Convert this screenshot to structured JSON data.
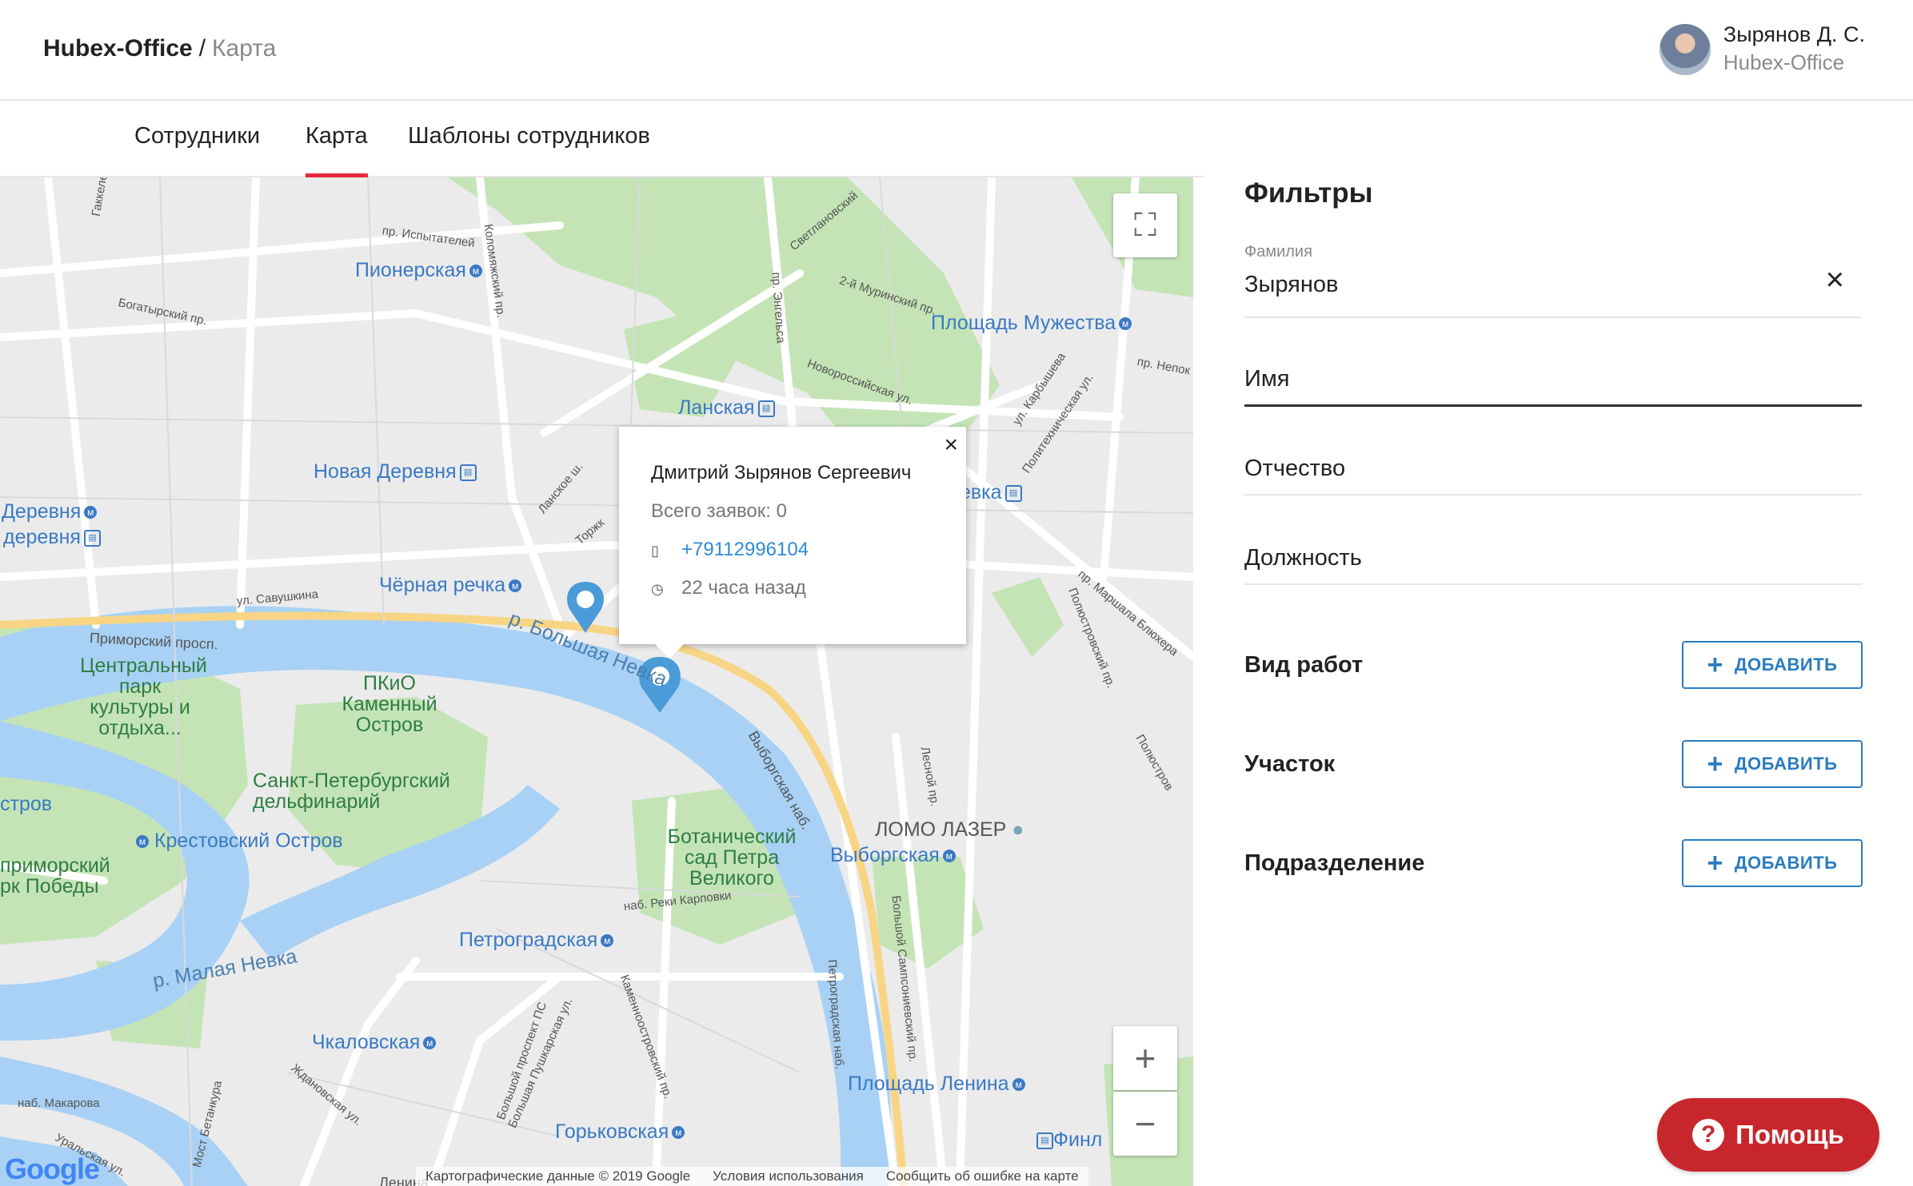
{
  "header": {
    "app_name": "Hubex-Office",
    "separator": "/",
    "page_name": "Карта",
    "user_name": "Зырянов Д. С.",
    "user_org": "Hubex-Office"
  },
  "tabs": [
    {
      "label": "Сотрудники",
      "active": false
    },
    {
      "label": "Карта",
      "active": true
    },
    {
      "label": "Шаблоны сотрудников",
      "active": false
    }
  ],
  "map": {
    "labels": {
      "pionerskaya": "Пионерская",
      "ploschad_muzhestva": "Площадь Мужества",
      "lanskaya": "Ланская",
      "novaya_derevnya": "Новая Деревня",
      "derevnya1": "Деревня",
      "derevnya2": "деревня",
      "chernaya_rechka": "Чёрная речка",
      "park_kultury": "Центральный парк культуры и отдыха...",
      "pkio": "ПКиО Каменный Остров",
      "dolfinarium": "Санкт-Петербургский дельфинарий",
      "krestovsky": "Крестовский Остров",
      "primorsky": "приморский рк Победы",
      "strov": "стров",
      "botanic": "Ботанический сад Петра Великого",
      "lomo": "ЛОМО ЛАЗЕР",
      "vyborgskaya": "Выборгская",
      "petrogradskaya": "Петроградская",
      "malaya_nevka": "р. Малая Невка",
      "bolshaya_nevka": "р. Большая Невка",
      "chkalovskaya": "Чкаловская",
      "ploschad_lenina": "Площадь Ленина",
      "gorkovskaya": "Горьковская",
      "finl": "Финл",
      "vka": "евка",
      "primorsky_prosp": "Приморский просп.",
      "vyborgskaya_nab": "Выборгская наб.",
      "ul_savushkina": "ул. Савушкина",
      "pr_ispytateley": "пр. Испытателей",
      "bogatyrsky": "Богатырский пр.",
      "kolomyazhsky": "Коломяжский пр.",
      "murinsky": "2-й Муринский пр.",
      "novorossiyskaya": "Новороссийская ул.",
      "nab_reki_karpovki": "наб. Реки Карповки",
      "svetlanovsky": "Светлановский",
      "engelsa": "пр. Энгельса",
      "lanskoe": "Ланское ш.",
      "marshala": "пр. Маршала Блюхера",
      "polyustrovsky": "Полюстровский пр.",
      "lesnoy": "Лесной пр.",
      "bolshoy_sampsonievsky": "Большой Сампсониевский пр.",
      "petrogradskaya_nab": "Петроградская наб.",
      "kamennoostrovsky": "Каменноостровский пр.",
      "bolshaya_pushkarskaya": "Большая Пушкарская ул.",
      "bolshoy_prospekt": "Большой проспект ПС",
      "zhdanovskaya": "Ждановская ул.",
      "nab_makarova": "наб. Макарова",
      "uralskaya": "Уральская ул.",
      "most_betankura": "Мост Бетанкура",
      "torzh": "Торжк",
      "gakkelevskaya": "Гаккелевская ул.",
      "karbysheva": "ул. Карбышева",
      "politekhnicheskaya": "Политехническая ул.",
      "pr_nepok": "пр. Непок",
      "polyustr2": "Полюстров",
      "lenina_bottom": "Ленина"
    },
    "popup": {
      "name": "Дмитрий Зырянов Сергеевич",
      "requests": "Всего заявок: 0",
      "phone": "+79112996104",
      "time": "22 часа назад",
      "close": "×"
    },
    "controls": {
      "fullscreen": "⛶",
      "zoom_in": "+",
      "zoom_out": "−"
    },
    "footer": {
      "google": "Google",
      "data": "Картографические данные © 2019 Google",
      "terms": "Условия использования",
      "report": "Сообщить об ошибке на карте"
    }
  },
  "filters": {
    "title": "Фильтры",
    "surname_label": "Фамилия",
    "surname_value": "Зырянов",
    "name_placeholder": "Имя",
    "patronymic_placeholder": "Отчество",
    "position_placeholder": "Должность",
    "sections": [
      {
        "label": "Вид работ",
        "button": "ДОБАВИТЬ"
      },
      {
        "label": "Участок",
        "button": "ДОБАВИТЬ"
      },
      {
        "label": "Подразделение",
        "button": "ДОБАВИТЬ"
      }
    ]
  },
  "help_button": "Помощь",
  "colors": {
    "accent": "#e8283a",
    "link": "#2e8ad8",
    "button_outline": "#2a7cc0",
    "help": "#c8262d",
    "water": "#a8d1f5",
    "park": "#c4e4b6"
  }
}
